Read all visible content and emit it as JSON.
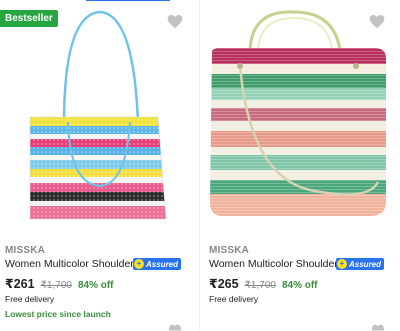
{
  "colors": {
    "badge": "#26a541",
    "price": "#212121",
    "discount": "#388e3c",
    "assured": "#2874f0",
    "muted": "#878787"
  },
  "top_strip": {
    "fragment": ""
  },
  "products": [
    {
      "badge": "Bestseller",
      "brand": "MISSKA",
      "title": "Women Multicolor Shoulder Bag",
      "assured_label": "Assured",
      "price": "₹261",
      "mrp": "₹1,700",
      "discount": "84% off",
      "delivery": "Free delivery",
      "note": "Lowest price since launch",
      "wishlist_icon": "heart-icon"
    },
    {
      "brand": "MISSKA",
      "title": "Women Multicolor Shoulder Bag",
      "assured_label": "Assured",
      "price": "₹265",
      "mrp": "₹1,700",
      "discount": "84% off",
      "delivery": "Free delivery",
      "wishlist_icon": "heart-icon"
    }
  ]
}
